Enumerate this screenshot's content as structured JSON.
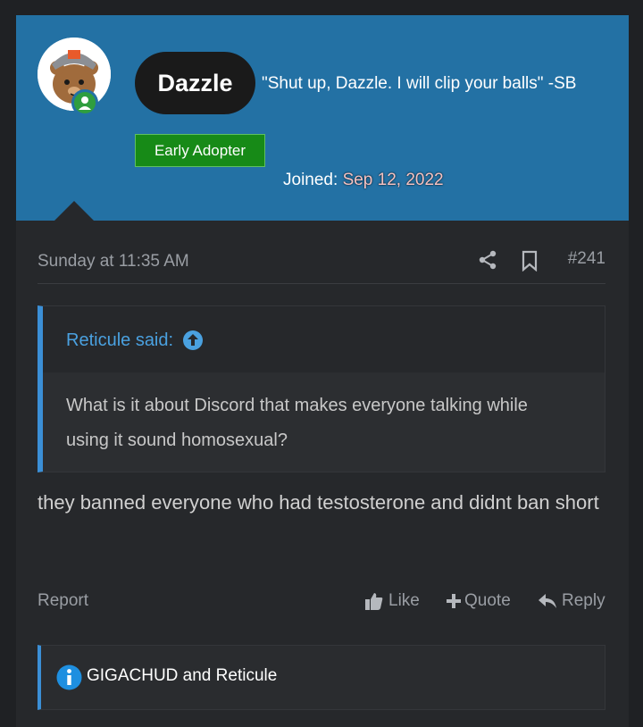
{
  "user": {
    "name": "Dazzle",
    "title": "\"Shut up, Dazzle. I will clip your balls\" -SB",
    "banner": "Early Adopter",
    "joined_label": "Joined:",
    "joined_date": "Sep 12, 2022"
  },
  "post": {
    "date": "Sunday at 11:35 AM",
    "number": "#241",
    "quote": {
      "author_label": "Reticule said:",
      "text": "What is it about Discord that makes everyone talking while using it sound homosexual?"
    },
    "body": "they banned everyone who had testosterone and didnt ban short"
  },
  "actions": {
    "report": "Report",
    "like": "Like",
    "quote": "Quote",
    "reply": "Reply"
  },
  "reactions": {
    "text": "GIGACHUD and Reticule"
  },
  "colors": {
    "header_bg": "#2371a4",
    "banner_bg": "#178a17",
    "accent": "#3b8fd6",
    "online": "#2f9e3f"
  },
  "icons": [
    "share-icon",
    "bookmark-icon",
    "arrow-up-circle-icon",
    "thumbs-up-icon",
    "plus-icon",
    "reply-icon",
    "info-icon"
  ]
}
